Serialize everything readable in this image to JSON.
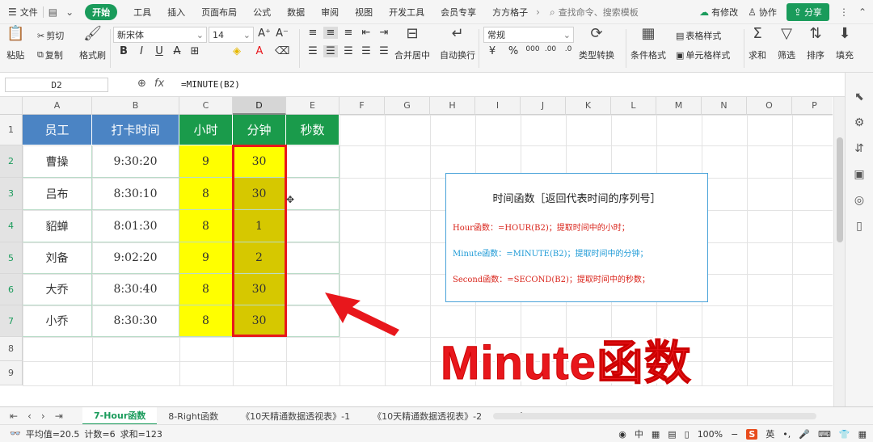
{
  "menubar": {
    "file": "文件",
    "tabs": [
      "开始",
      "工具",
      "插入",
      "页面布局",
      "公式",
      "数据",
      "审阅",
      "视图",
      "开发工具",
      "会员专享",
      "方方格子"
    ],
    "active_tab": "开始",
    "search_placeholder": "查找命令、搜索模板",
    "has_changes": "有修改",
    "collab": "协作",
    "share": "分享"
  },
  "toolbar": {
    "paste": "粘贴",
    "cut": "剪切",
    "copy": "复制",
    "format_painter": "格式刷",
    "font_name": "新宋体",
    "font_size": "14",
    "number_format": "常规",
    "merge_center": "合并居中",
    "wrap_text": "自动换行",
    "type_convert": "类型转换",
    "cond_format": "条件格式",
    "table_style": "表格样式",
    "cell_style": "单元格样式",
    "sum": "求和",
    "filter": "筛选",
    "sort": "排序",
    "fill": "填充"
  },
  "formulabar": {
    "cell_ref": "D2",
    "formula": "=MINUTE(B2)"
  },
  "columns": [
    "A",
    "B",
    "C",
    "D",
    "E",
    "F",
    "G",
    "H",
    "I",
    "J",
    "K",
    "L",
    "M",
    "N",
    "O",
    "P"
  ],
  "rows": [
    "1",
    "2",
    "3",
    "4",
    "5",
    "6",
    "7",
    "8",
    "9"
  ],
  "table": {
    "headers": [
      "员工",
      "打卡时间",
      "小时",
      "分钟",
      "秒数"
    ],
    "data": [
      [
        "曹操",
        "9:30:20",
        "9",
        "30",
        ""
      ],
      [
        "吕布",
        "8:30:10",
        "8",
        "30",
        ""
      ],
      [
        "貂蝉",
        "8:01:30",
        "8",
        "1",
        ""
      ],
      [
        "刘备",
        "9:02:20",
        "9",
        "2",
        ""
      ],
      [
        "大乔",
        "8:30:40",
        "8",
        "30",
        ""
      ],
      [
        "小乔",
        "8:30:30",
        "8",
        "30",
        ""
      ]
    ]
  },
  "infobox": {
    "title": "时间函数［返回代表时间的序列号］",
    "line_hour": "Hour函数：=HOUR(B2)；提取时间中的小时；",
    "line_minute": "Minute函数：=MINUTE(B2)；提取时间中的分钟；",
    "line_second": "Second函数：=SECOND(B2)；提取时间中的秒数；"
  },
  "overlay_label": "Minute函数",
  "sheets": [
    "7-Hour函数",
    "8-Right函数",
    "《10天精通数据透视表》-1",
    "《10天精通数据透视表》-2"
  ],
  "active_sheet": "7-Hour函数",
  "status": {
    "average": "平均值=20.5",
    "count": "计数=6",
    "sum": "求和=123",
    "zoom": "100%",
    "ime_lang": "英",
    "ime_mode": "中"
  },
  "colors": {
    "header_blue": "#4b84c4",
    "header_green": "#1a9b4b",
    "cell_yellow": "#ffff00",
    "cell_olive": "#d6c800",
    "accent_red": "#e8171c",
    "wps_green": "#1a9b5b"
  }
}
